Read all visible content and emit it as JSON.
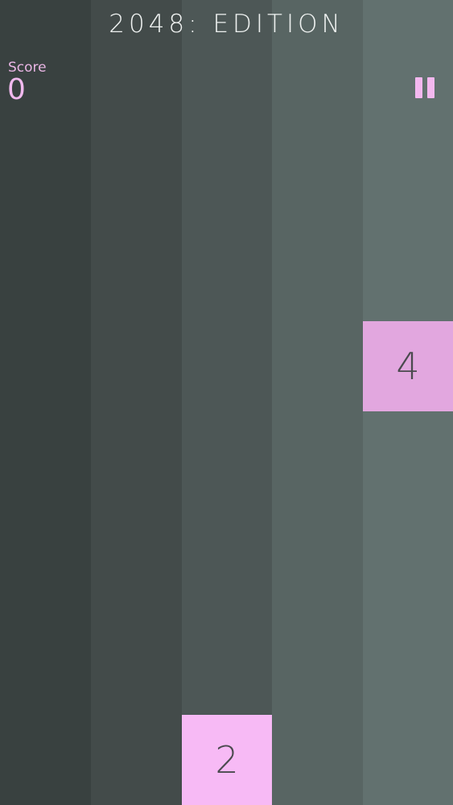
{
  "header": {
    "title": "2048: EDITION"
  },
  "score": {
    "label": "Score",
    "value": "0"
  },
  "controls": {
    "pause_icon": "pause-icon"
  },
  "columns": [
    {
      "color": "#394140"
    },
    {
      "color": "#434b4a"
    },
    {
      "color": "#4d5756"
    },
    {
      "color": "#586563"
    },
    {
      "color": "#62716f"
    }
  ],
  "tiles": [
    {
      "value": "4",
      "column": 5,
      "color": "#e2a7df"
    },
    {
      "value": "2",
      "column": 3,
      "color": "#f7baf5"
    }
  ],
  "colors": {
    "accent": "#f1b9ee",
    "title_text": "#eef1f0",
    "tile_text": "#4a4a4e"
  }
}
